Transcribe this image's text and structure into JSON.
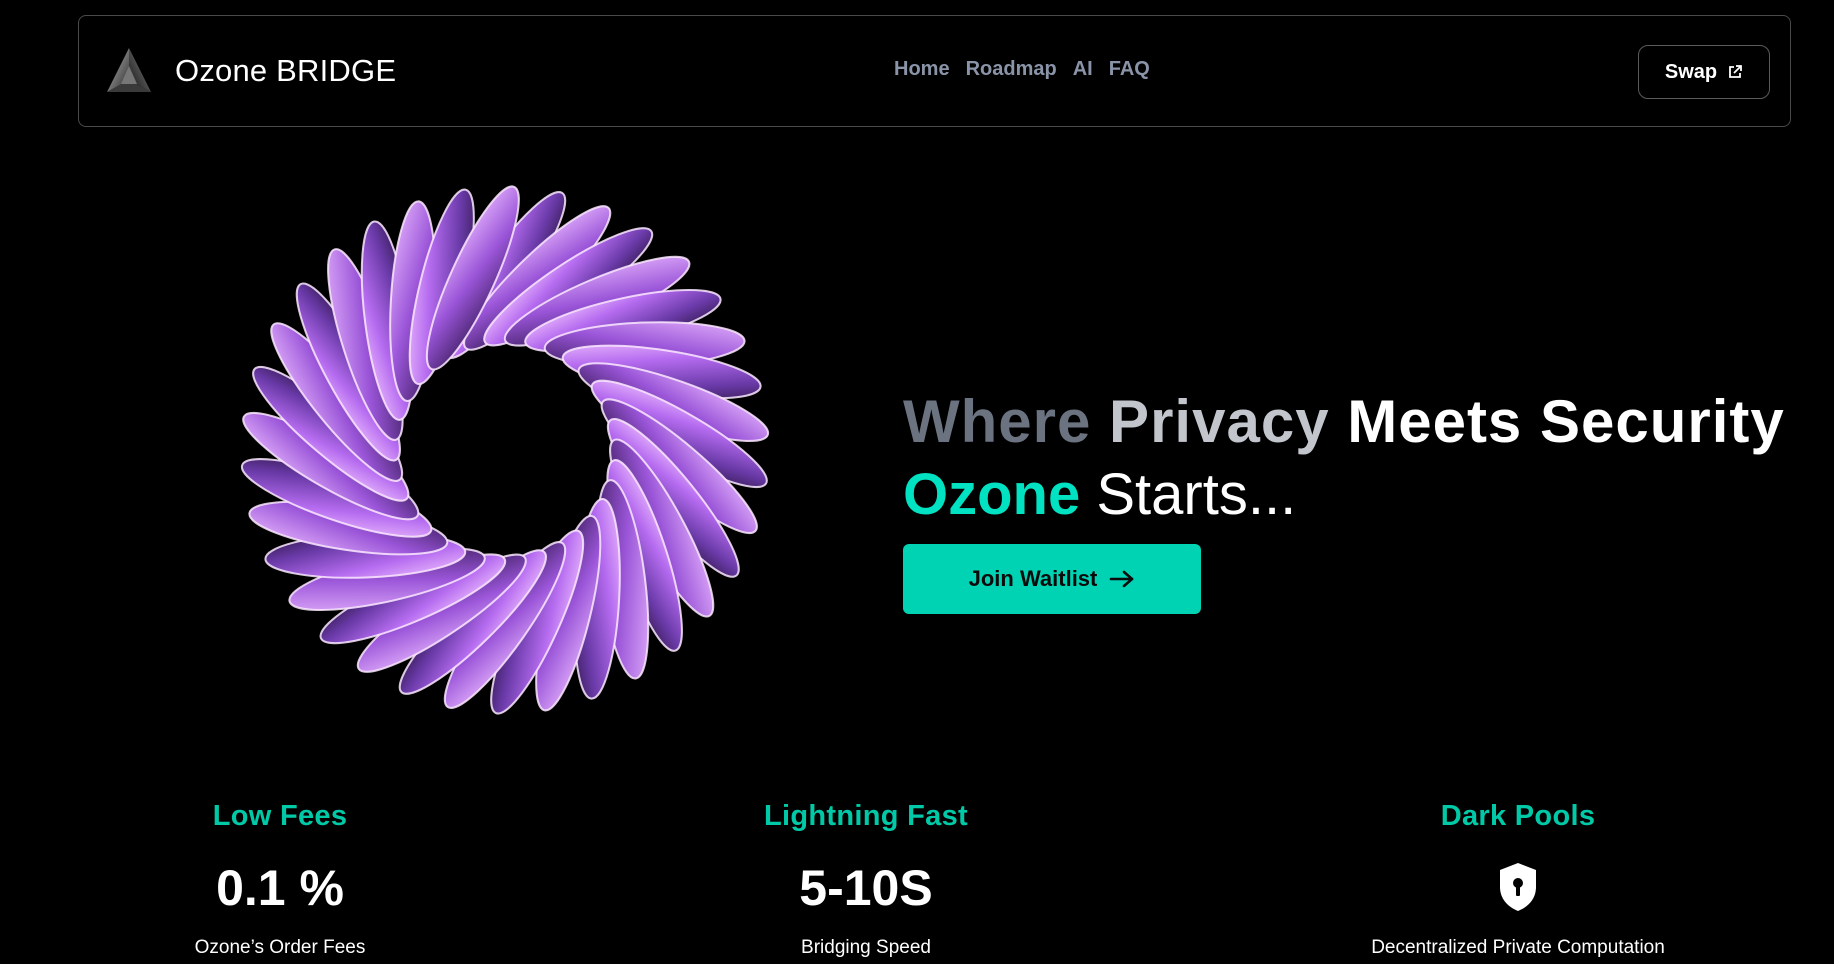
{
  "brand": {
    "name": "Ozone BRIDGE",
    "logo_icon": "triangle-logo-icon"
  },
  "nav": {
    "links": [
      "Home",
      "Roadmap",
      "AI",
      "FAQ"
    ]
  },
  "swap": {
    "label": "Swap",
    "icon": "external-link-icon"
  },
  "hero": {
    "headline_words": [
      "Where",
      "Privacy",
      "Meets Security"
    ],
    "subline_highlight": "Ozone",
    "subline_rest": "Starts...",
    "cta_label": "Join Waitlist",
    "cta_icon": "arrow-right-icon",
    "art_icon": "iridescent-ring-art"
  },
  "stats": [
    {
      "title": "Low Fees",
      "value": "0.1 %",
      "caption": "Ozone’s Order Fees"
    },
    {
      "title": "Lightning Fast",
      "value": "5-10S",
      "caption": "Bridging Speed"
    },
    {
      "title": "Dark Pools",
      "icon": "shield-lock-icon",
      "caption": "Decentralized Private Computation"
    }
  ],
  "colors": {
    "accent": "#00d3b4",
    "accent_text": "#00c9a7",
    "background": "#000000",
    "nav_text": "#8a94a8"
  }
}
